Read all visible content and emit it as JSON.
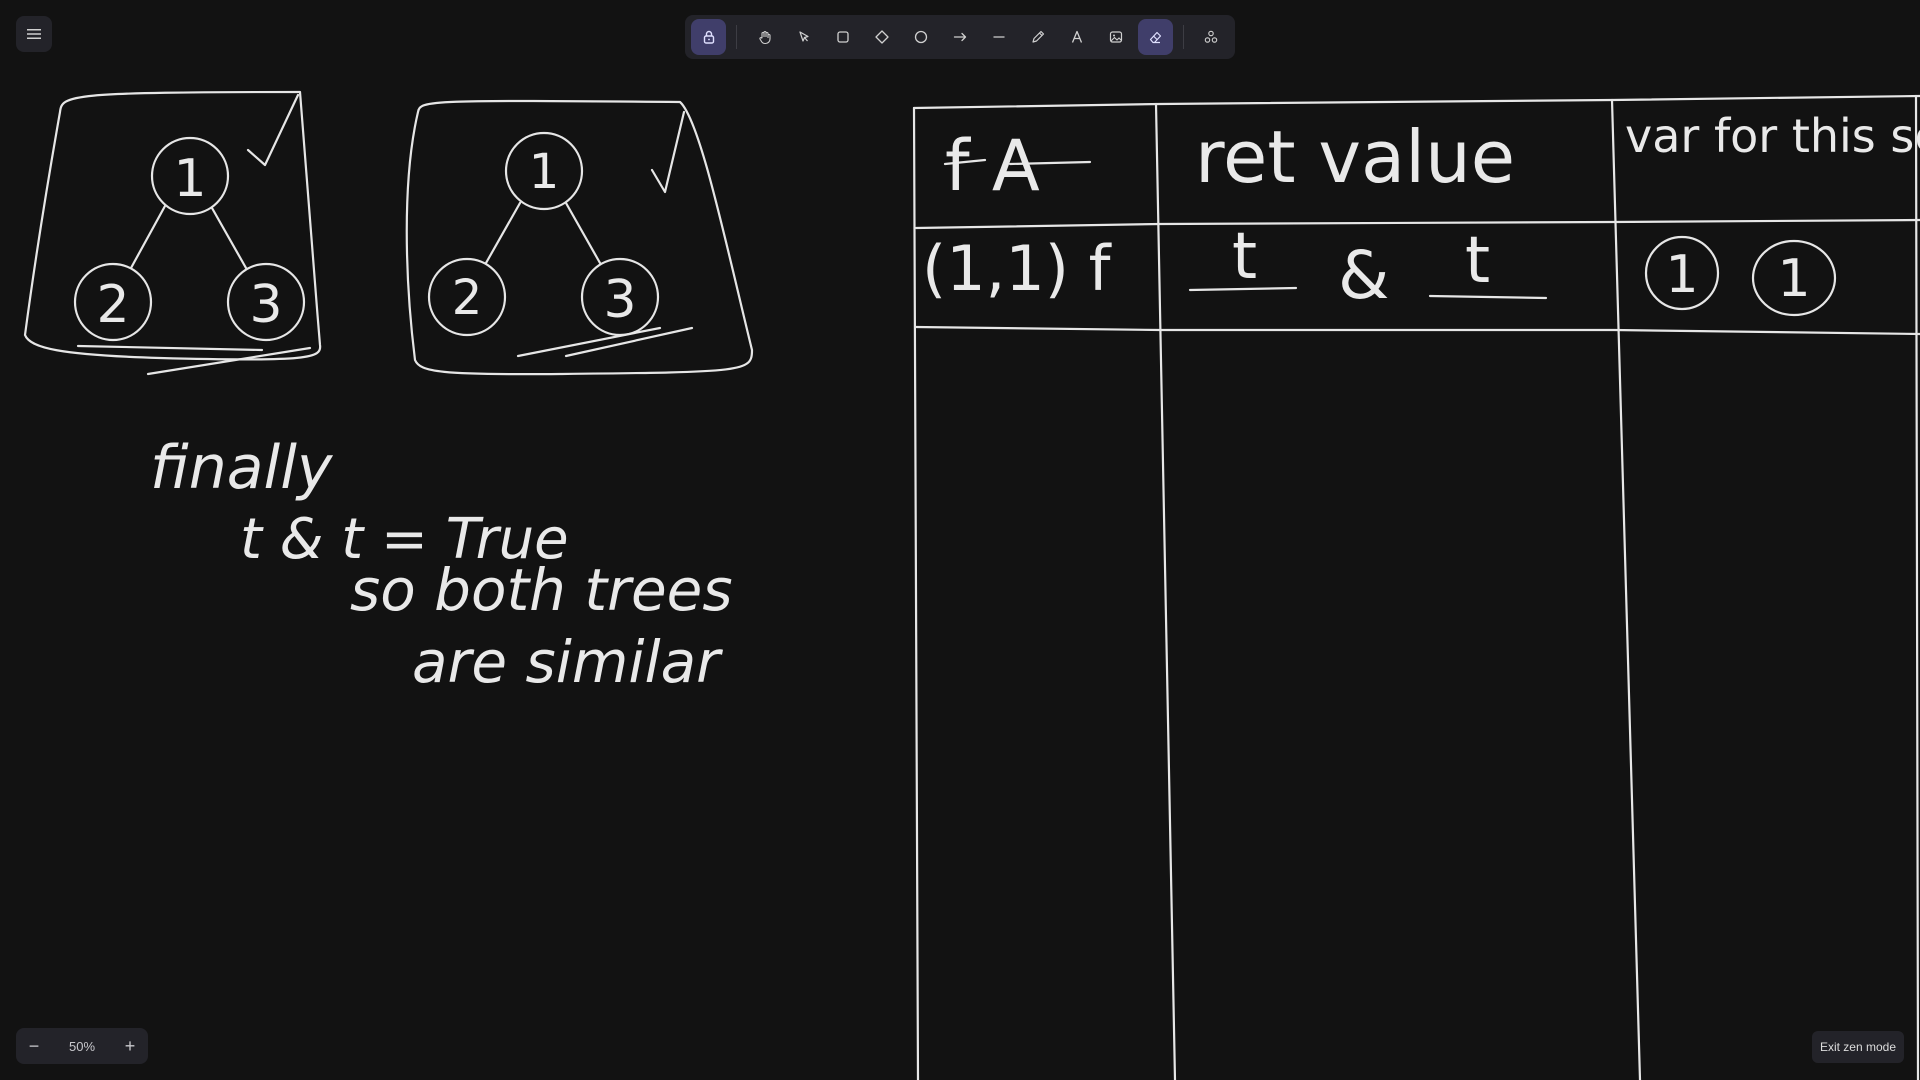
{
  "toolbar": {
    "tools": [
      {
        "name": "lock-icon",
        "active": true
      },
      {
        "name": "hand-icon",
        "active": false
      },
      {
        "name": "selection-icon",
        "active": false
      },
      {
        "name": "rectangle-icon",
        "active": false
      },
      {
        "name": "diamond-icon",
        "active": false
      },
      {
        "name": "ellipse-icon",
        "active": false
      },
      {
        "name": "arrow-icon",
        "active": false
      },
      {
        "name": "line-icon",
        "active": false
      },
      {
        "name": "pencil-icon",
        "active": false
      },
      {
        "name": "text-icon",
        "active": false
      },
      {
        "name": "image-icon",
        "active": false
      },
      {
        "name": "eraser-icon",
        "active": true
      },
      {
        "name": "shapes-library-icon",
        "active": false
      }
    ],
    "accent": "#403e6a"
  },
  "zoom": {
    "minus": "−",
    "value": "50%",
    "plus": "+"
  },
  "exit_zen": "Exit zen mode",
  "canvas": {
    "tree1": {
      "root": "1",
      "left": "2",
      "right": "3",
      "mark": "√"
    },
    "tree2": {
      "root": "1",
      "left": "2",
      "right": "3",
      "mark": "√"
    },
    "notes": {
      "line1": "finally",
      "line2": "t & t = True",
      "line3": "so both trees",
      "line4": "are similar"
    },
    "table": {
      "headers": [
        "f A",
        "ret value",
        "var for this scope"
      ],
      "row1": {
        "cell1": "(1,1) f",
        "cell2_left": "t",
        "cell2_op": "&",
        "cell2_right": "t",
        "cell3_a": "1",
        "cell3_b": "1"
      }
    }
  }
}
